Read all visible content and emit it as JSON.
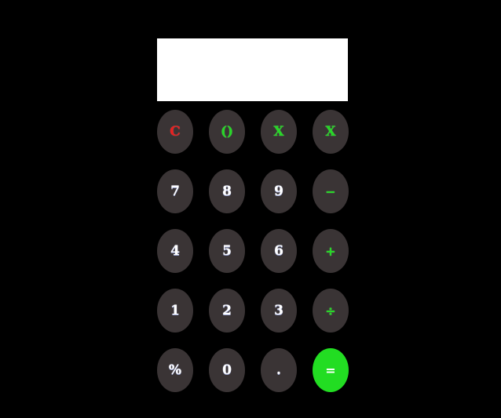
{
  "display": {
    "value": ""
  },
  "keys": {
    "clear": "C",
    "paren": "()",
    "x1": "X",
    "x2": "X",
    "seven": "7",
    "eight": "8",
    "nine": "9",
    "minus": "−",
    "four": "4",
    "five": "5",
    "six": "6",
    "plus": "+",
    "one": "1",
    "two": "2",
    "three": "3",
    "divide": "÷",
    "percent": "%",
    "zero": "0",
    "decimal": ".",
    "equals": "="
  },
  "colors": {
    "background": "#000000",
    "display": "#ffffff",
    "key": "#3a3435",
    "clear": "#e82020",
    "accent": "#27d827",
    "equals": "#22dd22"
  }
}
